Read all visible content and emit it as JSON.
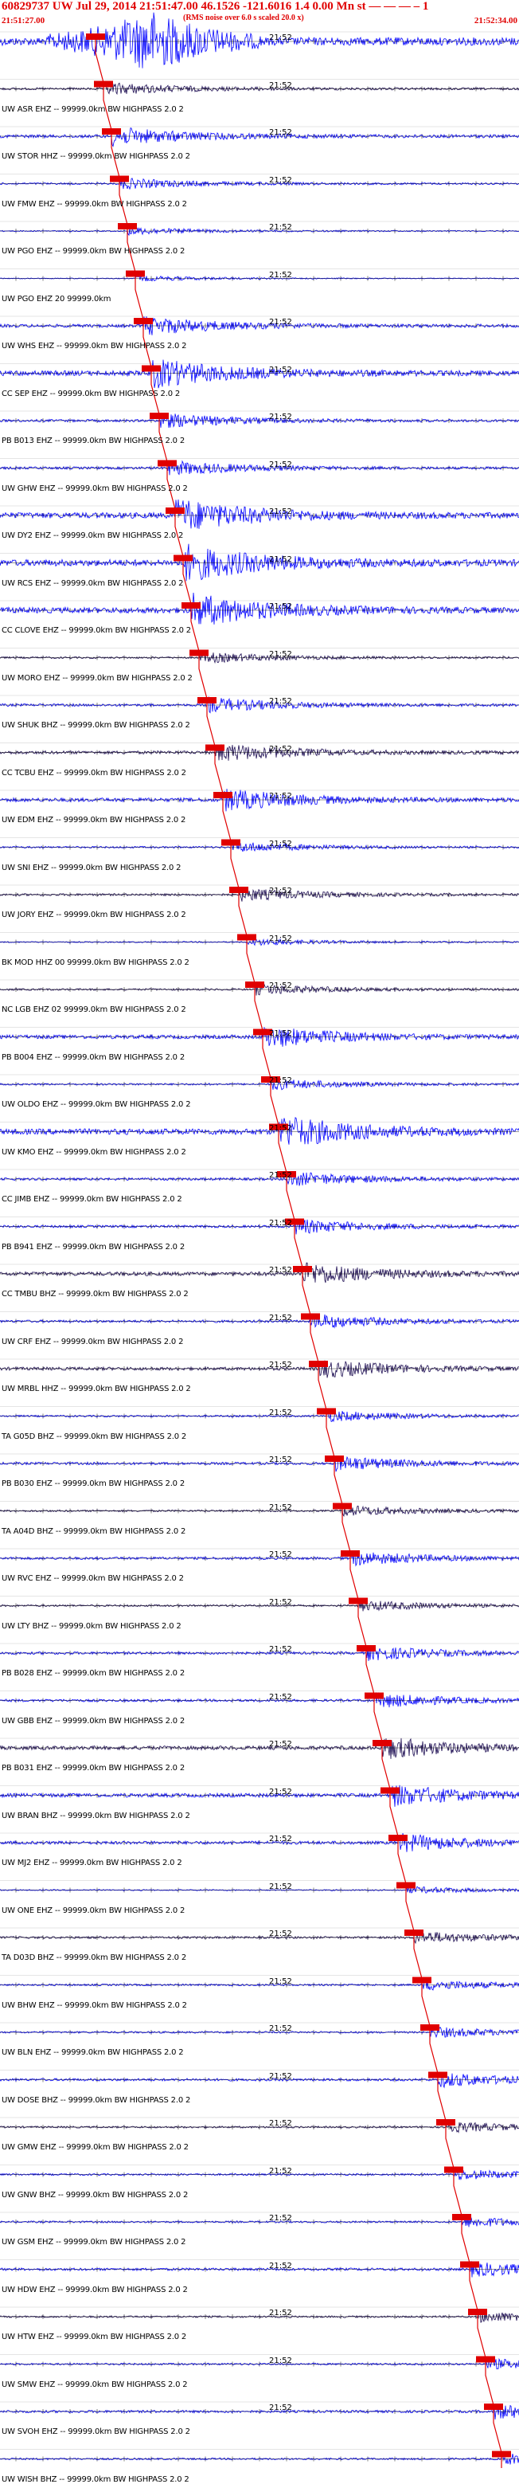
{
  "header": {
    "title": "60829737 UW Jul 29, 2014 21:51:47.00   46.1526 -121.6016  1.4 0.00 Mn st — — — – 1",
    "subtitle": "(RMS noise over 6.0 s scaled 20.0 x)",
    "start_time": "21:51:27.00",
    "end_time": "21:52:34.00"
  },
  "colors": {
    "trace_blue": "#0000ff",
    "trace_dark": "#1a0a50",
    "pick_red": "#e00000",
    "header_red": "#e00000"
  },
  "rows": [
    {
      "label": "",
      "time": "21:52",
      "pick": "",
      "color": "blue",
      "amp": 1.4
    },
    {
      "label": "UW ASR EHZ -- 99999.0km BW HIGHPASS 2.0 2",
      "time": "21:52",
      "pick": "",
      "color": "dark",
      "amp": 0.35
    },
    {
      "label": "UW STOR HHZ -- 99999.0km BW HIGHPASS 2.0 2",
      "time": "21:52",
      "pick": "",
      "color": "blue",
      "amp": 0.5
    },
    {
      "label": "UW FMW EHZ -- 99999.0km BW HIGHPASS 2.0 2",
      "time": "21:52",
      "pick": "",
      "color": "blue",
      "amp": 0.3
    },
    {
      "label": "UW PGO EHZ -- 99999.0km BW HIGHPASS 2.0 2",
      "time": "21:52",
      "pick": "",
      "color": "blue",
      "amp": 0.2
    },
    {
      "label": "UW PGO EHZ 20 99999.0km",
      "time": "21:52",
      "pick": "",
      "color": "blue",
      "amp": 0.15
    },
    {
      "label": "UW WHS EHZ -- 99999.0km BW HIGHPASS 2.0 2",
      "time": "21:52",
      "pick": "",
      "color": "blue",
      "amp": 0.5
    },
    {
      "label": "CC SEP EHZ -- 99999.0km BW HIGHPASS 2.0 2",
      "time": "21:52",
      "pick": "",
      "color": "blue",
      "amp": 0.8
    },
    {
      "label": "PB B013 EHZ -- 99999.0km BW HIGHPASS 2.0 2",
      "time": "21:52",
      "pick": "",
      "color": "blue",
      "amp": 0.4
    },
    {
      "label": "UW GHW EHZ -- 99999.0km BW HIGHPASS 2.0 2",
      "time": "21:52",
      "pick": "",
      "color": "blue",
      "amp": 0.4
    },
    {
      "label": "UW DY2 EHZ -- 99999.0km BW HIGHPASS 2.0 2",
      "time": "21:52",
      "pick": "",
      "color": "blue",
      "amp": 0.9
    },
    {
      "label": "UW RCS EHZ -- 99999.0km BW HIGHPASS 2.0 2",
      "time": "21:52",
      "pick": "",
      "color": "blue",
      "amp": 1.0
    },
    {
      "label": "CC CLOVE EHZ -- 99999.0km BW HIGHPASS 2.0 2",
      "time": "21:52",
      "pick": "",
      "color": "blue",
      "amp": 0.9
    },
    {
      "label": "UW MORO EHZ -- 99999.0km BW HIGHPASS 2.0 2",
      "time": "21:52",
      "pick": "",
      "color": "dark",
      "amp": 0.3
    },
    {
      "label": "UW SHUK BHZ -- 99999.0km BW HIGHPASS 2.0 2",
      "time": "21:52",
      "pick": "",
      "color": "blue",
      "amp": 0.4
    },
    {
      "label": "CC TCBU EHZ -- 99999.0km BW HIGHPASS 2.0 2",
      "time": "21:52",
      "pick": "",
      "color": "dark",
      "amp": 0.5
    },
    {
      "label": "UW EDM EHZ -- 99999.0km BW HIGHPASS 2.0 2",
      "time": "21:52",
      "pick": "",
      "color": "blue",
      "amp": 0.6
    },
    {
      "label": "UW SNI EHZ -- 99999.0km BW HIGHPASS 2.0 2",
      "time": "21:52",
      "pick": "",
      "color": "blue",
      "amp": 0.3
    },
    {
      "label": "UW JORY EHZ -- 99999.0km BW HIGHPASS 2.0 2",
      "time": "21:52",
      "pick": "",
      "color": "dark",
      "amp": 0.35
    },
    {
      "label": "BK MOD HHZ 00 99999.0km BW HIGHPASS 2.0 2",
      "time": "21:52",
      "pick": "",
      "color": "blue",
      "amp": 0.2
    },
    {
      "label": "NC LGB EHZ 02 99999.0km BW HIGHPASS 2.0 2",
      "time": "21:52",
      "pick": "",
      "color": "dark",
      "amp": 0.3
    },
    {
      "label": "PB B004 EHZ -- 99999.0km BW HIGHPASS 2.0 2",
      "time": "21:52",
      "pick": "",
      "color": "blue",
      "amp": 0.6
    },
    {
      "label": "UW OLDO EHZ -- 99999.0km BW HIGHPASS 2.0 2",
      "time": "21:52",
      "pick": "",
      "color": "blue",
      "amp": 0.3
    },
    {
      "label": "UW KMO EHZ -- 99999.0km BW HIGHPASS 2.0 2",
      "time": "21:52",
      "pick": "",
      "color": "blue",
      "amp": 0.9
    },
    {
      "label": "CC JIMB EHZ -- 99999.0km BW HIGHPASS 2.0 2",
      "time": "21:52",
      "pick": "",
      "color": "blue",
      "amp": 0.4
    },
    {
      "label": "PB B941 EHZ -- 99999.0km BW HIGHPASS 2.0 2",
      "time": "21:52",
      "pick": "",
      "color": "blue",
      "amp": 0.4
    },
    {
      "label": "CC TMBU BHZ -- 99999.0km BW HIGHPASS 2.0 2",
      "time": "21:52",
      "pick": "",
      "color": "dark",
      "amp": 0.6
    },
    {
      "label": "UW CRF EHZ -- 99999.0km BW HIGHPASS 2.0 2",
      "time": "21:52",
      "pick": "",
      "color": "blue",
      "amp": 0.4
    },
    {
      "label": "UW MRBL HHZ -- 99999.0km BW HIGHPASS 2.0 2",
      "time": "21:52",
      "pick": "",
      "color": "dark",
      "amp": 0.5
    },
    {
      "label": "TA G05D BHZ -- 99999.0km BW HIGHPASS 2.0 2",
      "time": "21:52",
      "pick": "",
      "color": "blue",
      "amp": 0.3
    },
    {
      "label": "PB B030 EHZ -- 99999.0km BW HIGHPASS 2.0 2",
      "time": "21:52",
      "pick": "",
      "color": "blue",
      "amp": 0.4
    },
    {
      "label": "TA A04D BHZ -- 99999.0km BW HIGHPASS 2.0 2",
      "time": "21:52",
      "pick": "",
      "color": "dark",
      "amp": 0.3
    },
    {
      "label": "UW RVC EHZ -- 99999.0km BW HIGHPASS 2.0 2",
      "time": "21:52",
      "pick": "",
      "color": "blue",
      "amp": 0.4
    },
    {
      "label": "UW LTY BHZ -- 99999.0km BW HIGHPASS 2.0 2",
      "time": "21:52",
      "pick": "",
      "color": "dark",
      "amp": 0.3
    },
    {
      "label": "PB B028 EHZ -- 99999.0km BW HIGHPASS 2.0 2",
      "time": "21:52",
      "pick": "",
      "color": "blue",
      "amp": 0.4
    },
    {
      "label": "UW GBB EHZ -- 99999.0km BW HIGHPASS 2.0 2",
      "time": "21:52",
      "pick": "",
      "color": "blue",
      "amp": 0.4
    },
    {
      "label": "PB B031 EHZ -- 99999.0km BW HIGHPASS 2.0 2",
      "time": "21:52",
      "pick": "",
      "color": "dark",
      "amp": 0.6
    },
    {
      "label": "UW BRAN BHZ -- 99999.0km BW HIGHPASS 2.0 2",
      "time": "21:52",
      "pick": "",
      "color": "blue",
      "amp": 0.6
    },
    {
      "label": "UW MJ2 EHZ -- 99999.0km BW HIGHPASS 2.0 2",
      "time": "21:52",
      "pick": "",
      "color": "blue",
      "amp": 0.5
    },
    {
      "label": "UW ONE EHZ -- 99999.0km BW HIGHPASS 2.0 2",
      "time": "21:52",
      "pick": "",
      "color": "blue",
      "amp": 0.2
    },
    {
      "label": "TA D03D BHZ -- 99999.0km BW HIGHPASS 2.0 2",
      "time": "21:52",
      "pick": "",
      "color": "dark",
      "amp": 0.35
    },
    {
      "label": "UW BHW EHZ -- 99999.0km BW HIGHPASS 2.0 2",
      "time": "21:52",
      "pick": "",
      "color": "blue",
      "amp": 0.3
    },
    {
      "label": "UW BLN EHZ -- 99999.0km BW HIGHPASS 2.0 2",
      "time": "21:52",
      "pick": "",
      "color": "blue",
      "amp": 0.3
    },
    {
      "label": "UW DOSE BHZ -- 99999.0km BW HIGHPASS 2.0 2",
      "time": "21:52",
      "pick": "",
      "color": "blue",
      "amp": 0.4
    },
    {
      "label": "UW GMW EHZ -- 99999.0km BW HIGHPASS 2.0 2",
      "time": "21:52",
      "pick": "",
      "color": "dark",
      "amp": 0.3
    },
    {
      "label": "UW GNW BHZ -- 99999.0km BW HIGHPASS 2.0 2",
      "time": "21:52",
      "pick": "",
      "color": "blue",
      "amp": 0.3
    },
    {
      "label": "UW GSM EHZ -- 99999.0km BW HIGHPASS 2.0 2",
      "time": "21:52",
      "pick": "",
      "color": "blue",
      "amp": 0.3
    },
    {
      "label": "UW HDW EHZ -- 99999.0km BW HIGHPASS 2.0 2",
      "time": "21:52",
      "pick": "",
      "color": "blue",
      "amp": 0.4
    },
    {
      "label": "UW HTW EHZ -- 99999.0km BW HIGHPASS 2.0 2",
      "time": "21:52",
      "pick": "",
      "color": "dark",
      "amp": 0.3
    },
    {
      "label": "UW SMW EHZ -- 99999.0km BW HIGHPASS 2.0 2",
      "time": "21:52",
      "pick": "",
      "color": "blue",
      "amp": 0.3
    },
    {
      "label": "UW SVOH EHZ -- 99999.0km BW HIGHPASS 2.0 2",
      "time": "21:52",
      "pick": "",
      "color": "blue",
      "amp": 0.4
    },
    {
      "label": "UW WISH BHZ -- 99999.0km BW HIGHPASS 2.0 2",
      "time": "",
      "pick": "",
      "color": "blue",
      "amp": 0.3
    }
  ]
}
